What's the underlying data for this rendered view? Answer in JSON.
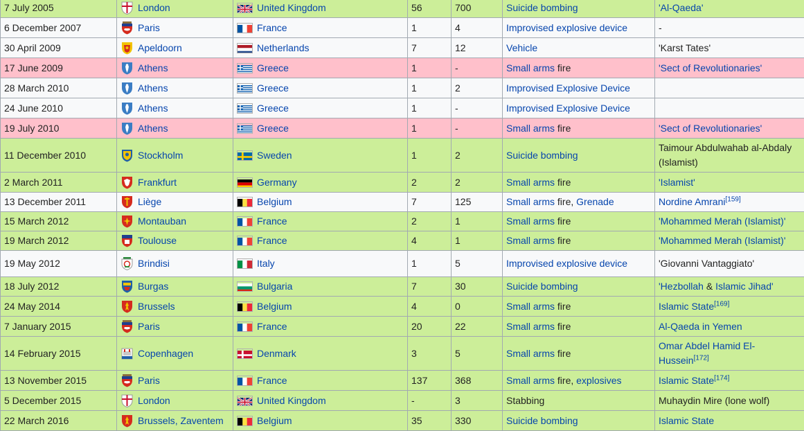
{
  "rows": [
    {
      "row_class": "green",
      "height": 29,
      "date": "7 July 2005",
      "city": "London",
      "coat": "london-coat-of-arms",
      "country": "United Kingdom",
      "flag": "uk",
      "deaths": "56",
      "injuries": "700",
      "method": [
        {
          "t": "Suicide bombing",
          "l": true
        }
      ],
      "perp": [
        {
          "t": "'Al-Qaeda'",
          "l": true
        }
      ]
    },
    {
      "row_class": "white",
      "height": 29,
      "date": "6 December 2007",
      "city": "Paris",
      "coat": "paris-coat-of-arms",
      "country": "France",
      "flag": "fr",
      "deaths": "1",
      "injuries": "4",
      "method": [
        {
          "t": "Improvised explosive device",
          "l": true
        }
      ],
      "perp": [
        {
          "t": "-",
          "l": false
        }
      ]
    },
    {
      "row_class": "white",
      "height": 29,
      "date": "30 April 2009",
      "city": "Apeldoorn",
      "coat": "apeldoorn-coat-of-arms",
      "country": "Netherlands",
      "flag": "nl",
      "deaths": "7",
      "injuries": "12",
      "method": [
        {
          "t": "Vehicle",
          "l": true
        }
      ],
      "perp": [
        {
          "t": "'Karst Tates'",
          "l": false
        }
      ]
    },
    {
      "row_class": "pink",
      "height": 29,
      "date": "17 June 2009",
      "city": "Athens",
      "coat": "athens-coat-of-arms",
      "country": "Greece",
      "flag": "gr",
      "deaths": "1",
      "injuries": "-",
      "method": [
        {
          "t": "Small arms",
          "l": true
        },
        {
          "t": " fire",
          "l": false
        }
      ],
      "perp": [
        {
          "t": "'Sect of Revolutionaries'",
          "l": true
        }
      ]
    },
    {
      "row_class": "white",
      "height": 29,
      "date": "28 March 2010",
      "city": "Athens",
      "coat": "athens-coat-of-arms",
      "country": "Greece",
      "flag": "gr",
      "deaths": "1",
      "injuries": "2",
      "method": [
        {
          "t": "Improvised Explosive Device",
          "l": true
        }
      ],
      "perp": []
    },
    {
      "row_class": "white",
      "height": 29,
      "date": "24 June 2010",
      "city": "Athens",
      "coat": "athens-coat-of-arms",
      "country": "Greece",
      "flag": "gr",
      "deaths": "1",
      "injuries": "-",
      "method": [
        {
          "t": "Improvised Explosive Device",
          "l": true
        }
      ],
      "perp": []
    },
    {
      "row_class": "pink",
      "height": 29,
      "date": "19 July 2010",
      "city": "Athens",
      "coat": "athens-coat-of-arms",
      "country": "Greece",
      "flag": "gr",
      "deaths": "1",
      "injuries": "-",
      "method": [
        {
          "t": "Small arms",
          "l": true
        },
        {
          "t": " fire",
          "l": false
        }
      ],
      "perp": [
        {
          "t": "'Sect of Revolutionaries'",
          "l": true
        }
      ]
    },
    {
      "row_class": "green",
      "height": 49,
      "date": "11 December 2010",
      "city": "Stockholm",
      "coat": "stockholm-coat-of-arms",
      "country": "Sweden",
      "flag": "se",
      "deaths": "1",
      "injuries": "2",
      "method": [
        {
          "t": "Suicide bombing",
          "l": true
        }
      ],
      "perp": [
        {
          "t": "Taimour Abdulwahab al-Abdaly (Islamist)",
          "l": false
        }
      ]
    },
    {
      "row_class": "green",
      "height": 29,
      "date": "2 March 2011",
      "city": "Frankfurt",
      "coat": "frankfurt-coat-of-arms",
      "country": "Germany",
      "flag": "de",
      "deaths": "2",
      "injuries": "2",
      "method": [
        {
          "t": "Small arms",
          "l": true
        },
        {
          "t": " fire",
          "l": false
        }
      ],
      "perp": [
        {
          "t": "'Islamist'",
          "l": true
        }
      ]
    },
    {
      "row_class": "white",
      "height": 28,
      "date": "13 December 2011",
      "city": "Liège",
      "coat": "liege-coat-of-arms",
      "country": "Belgium",
      "flag": "be",
      "deaths": "7",
      "injuries": "125",
      "method": [
        {
          "t": "Small arms",
          "l": true
        },
        {
          "t": " fire, ",
          "l": false
        },
        {
          "t": "Grenade",
          "l": true
        }
      ],
      "perp": [
        {
          "t": "Nordine Amrani",
          "l": true
        },
        {
          "t": "[159]",
          "l": "sup"
        }
      ]
    },
    {
      "row_class": "green",
      "height": 28,
      "date": "15 March 2012",
      "city": "Montauban",
      "coat": "montauban-coat-of-arms",
      "country": "France",
      "flag": "fr",
      "deaths": "2",
      "injuries": "1",
      "method": [
        {
          "t": "Small arms",
          "l": true
        },
        {
          "t": " fire",
          "l": false
        }
      ],
      "perp": [
        {
          "t": "'Mohammed Merah (Islamist)'",
          "l": true
        }
      ]
    },
    {
      "row_class": "green",
      "height": 28,
      "date": "19 March 2012",
      "city": "Toulouse",
      "coat": "toulouse-coat-of-arms",
      "country": "France",
      "flag": "fr",
      "deaths": "4",
      "injuries": "1",
      "method": [
        {
          "t": "Small arms",
          "l": true
        },
        {
          "t": " fire",
          "l": false
        }
      ],
      "perp": [
        {
          "t": "'Mohammed Merah (Islamist)'",
          "l": true
        }
      ]
    },
    {
      "row_class": "white",
      "height": 38,
      "date": "19 May 2012",
      "city": "Brindisi",
      "coat": "brindisi-coat-of-arms",
      "country": "Italy",
      "flag": "it",
      "deaths": "1",
      "injuries": "5",
      "method": [
        {
          "t": "Improvised explosive device",
          "l": true
        }
      ],
      "perp": [
        {
          "t": "'Giovanni Vantaggiato'",
          "l": false
        }
      ]
    },
    {
      "row_class": "green",
      "height": 28,
      "date": "18 July 2012",
      "city": "Burgas",
      "coat": "burgas-coat-of-arms",
      "country": "Bulgaria",
      "flag": "bg",
      "deaths": "7",
      "injuries": "30",
      "method": [
        {
          "t": "Suicide bombing",
          "l": true
        }
      ],
      "perp": [
        {
          "t": "'Hezbollah",
          "l": true
        },
        {
          "t": " & ",
          "l": false
        },
        {
          "t": "Islamic Jihad'",
          "l": true
        }
      ]
    },
    {
      "row_class": "green",
      "height": 29,
      "date": "24 May 2014",
      "city": "Brussels",
      "coat": "brussels-coat-of-arms",
      "country": "Belgium",
      "flag": "be",
      "deaths": "4",
      "injuries": "0",
      "method": [
        {
          "t": "Small arms",
          "l": true
        },
        {
          "t": " fire",
          "l": false
        }
      ],
      "perp": [
        {
          "t": "Islamic State",
          "l": true
        },
        {
          "t": "[169]",
          "l": "sup"
        }
      ]
    },
    {
      "row_class": "green",
      "height": 29,
      "date": "7 January 2015",
      "city": "Paris",
      "coat": "paris-coat-of-arms",
      "country": "France",
      "flag": "fr",
      "deaths": "20",
      "injuries": "22",
      "method": [
        {
          "t": "Small arms",
          "l": true
        },
        {
          "t": " fire",
          "l": false
        }
      ],
      "perp": [
        {
          "t": "Al-Qaeda in Yemen",
          "l": true
        }
      ]
    },
    {
      "row_class": "green",
      "height": 49,
      "date": "14 February 2015",
      "city": "Copenhagen",
      "coat": "copenhagen-coat-of-arms",
      "country": "Denmark",
      "flag": "dk",
      "deaths": "3",
      "injuries": "5",
      "method": [
        {
          "t": "Small arms",
          "l": true
        },
        {
          "t": " fire",
          "l": false
        }
      ],
      "perp": [
        {
          "t": "Omar Abdel Hamid El-Hussein",
          "l": true
        },
        {
          "t": "[172]",
          "l": "sup"
        }
      ]
    },
    {
      "row_class": "green",
      "height": 29,
      "date": "13 November 2015",
      "city": "Paris",
      "coat": "paris-coat-of-arms",
      "country": "France",
      "flag": "fr",
      "deaths": "137",
      "injuries": "368",
      "method": [
        {
          "t": "Small arms",
          "l": true
        },
        {
          "t": " fire, ",
          "l": false
        },
        {
          "t": "explosives",
          "l": true
        }
      ],
      "perp": [
        {
          "t": "Islamic State",
          "l": true
        },
        {
          "t": "[174]",
          "l": "sup"
        }
      ]
    },
    {
      "row_class": "green",
      "height": 29,
      "date": "5 December 2015",
      "city": "London",
      "coat": "london-coat-of-arms",
      "country": "United Kingdom",
      "flag": "uk",
      "deaths": "-",
      "injuries": "3",
      "method": [
        {
          "t": "Stabbing",
          "l": false
        }
      ],
      "perp": [
        {
          "t": "Muhaydin Mire (lone wolf)",
          "l": false
        }
      ]
    },
    {
      "row_class": "green",
      "height": 29,
      "date": "22 March 2016",
      "city": "Brussels",
      "city2": "Zaventem",
      "coat": "brussels-coat-of-arms",
      "country": "Belgium",
      "flag": "be",
      "deaths": "35",
      "injuries": "330",
      "method": [
        {
          "t": "Suicide bombing",
          "l": true
        }
      ],
      "perp": [
        {
          "t": "Islamic State",
          "l": true
        }
      ]
    }
  ],
  "colors": {
    "green": "#ccee99",
    "white": "#f8f9fa",
    "pink": "#ffc0cb",
    "link": "#0645ad",
    "border": "#a2a9b1"
  },
  "city_separator": ", "
}
